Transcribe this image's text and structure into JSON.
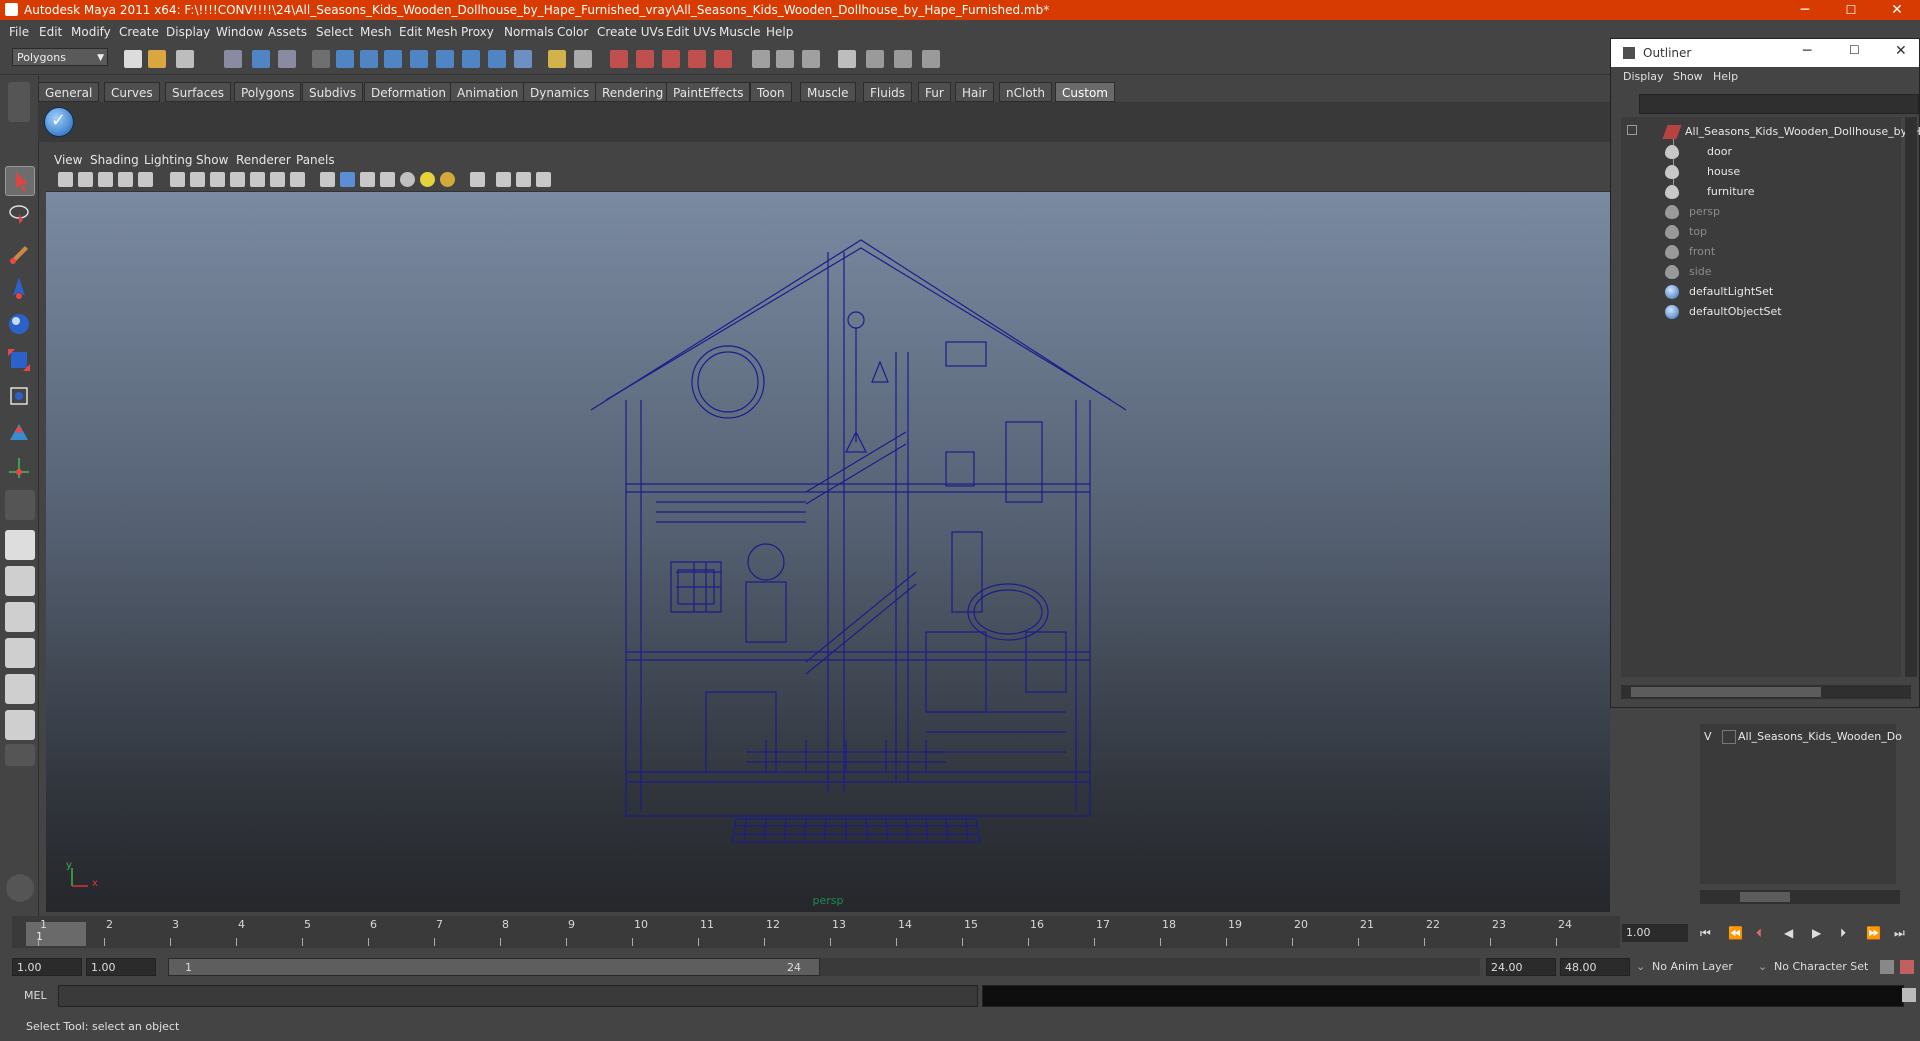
{
  "window": {
    "title": "Autodesk Maya 2011 x64: F:\\!!!!CONV!!!!\\24\\All_Seasons_Kids_Wooden_Dollhouse_by_Hape_Furnished_vray\\All_Seasons_Kids_Wooden_Dollhouse_by_Hape_Furnished.mb*",
    "accent": "#d83b01",
    "controls": {
      "minimize": "─",
      "maximize": "☐",
      "close": "✕"
    }
  },
  "menubar": [
    "File",
    "Edit",
    "Modify",
    "Create",
    "Display",
    "Window",
    "Assets",
    "Select",
    "Mesh",
    "Edit Mesh",
    "Proxy",
    "Normals",
    "Color",
    "Create UVs",
    "Edit UVs",
    "Muscle",
    "Help"
  ],
  "status_line": {
    "mode": "Polygons"
  },
  "shelf": {
    "tabs": [
      "General",
      "Curves",
      "Surfaces",
      "Polygons",
      "Subdivs",
      "Deformation",
      "Animation",
      "Dynamics",
      "Rendering",
      "PaintEffects",
      "Toon",
      "Muscle",
      "Fluids",
      "Fur",
      "Hair",
      "nCloth",
      "Custom"
    ],
    "active_tab": "Custom",
    "items": [
      "checkmark-icon"
    ]
  },
  "panel": {
    "menus": [
      "View",
      "Shading",
      "Lighting",
      "Show",
      "Renderer",
      "Panels"
    ],
    "camera_label": "persp",
    "axis": {
      "y": "y",
      "x": "x"
    },
    "wireframe_color": "#1c1c8a"
  },
  "outliner": {
    "title": "Outliner",
    "controls": {
      "minimize": "─",
      "maximize": "☐",
      "close": "✕"
    },
    "menus": [
      "Display",
      "Show",
      "Help"
    ],
    "items": [
      {
        "label": "All_Seasons_Kids_Wooden_Dollhouse_by_Ha",
        "icon": "mesh-group-icon",
        "level": 0,
        "dim": false
      },
      {
        "label": "door",
        "icon": "visibility-eye-icon",
        "level": 1,
        "dim": false
      },
      {
        "label": "house",
        "icon": "visibility-eye-icon",
        "level": 1,
        "dim": false
      },
      {
        "label": "furniture",
        "icon": "visibility-eye-icon",
        "level": 1,
        "dim": false
      },
      {
        "label": "persp",
        "icon": "camera-icon",
        "level": 0,
        "dim": true
      },
      {
        "label": "top",
        "icon": "camera-icon",
        "level": 0,
        "dim": true
      },
      {
        "label": "front",
        "icon": "camera-icon",
        "level": 0,
        "dim": true
      },
      {
        "label": "side",
        "icon": "camera-icon",
        "level": 0,
        "dim": true
      },
      {
        "label": "defaultLightSet",
        "icon": "set-icon",
        "level": 0,
        "dim": false
      },
      {
        "label": "defaultObjectSet",
        "icon": "set-icon",
        "level": 0,
        "dim": false
      }
    ]
  },
  "layer_editor": {
    "layer_visible": "V",
    "layer_name": "All_Seasons_Kids_Wooden_Do"
  },
  "timeline": {
    "ticks": [
      "1",
      "2",
      "3",
      "4",
      "5",
      "6",
      "7",
      "8",
      "9",
      "10",
      "11",
      "12",
      "13",
      "14",
      "15",
      "16",
      "17",
      "18",
      "19",
      "20",
      "21",
      "22",
      "23",
      "24"
    ],
    "current_frame": "1",
    "current_time_field": "1.00"
  },
  "range": {
    "start": "1.00",
    "playback_start": "1.00",
    "slider_start": "1",
    "slider_end": "24",
    "playback_end": "24.00",
    "end": "48.00",
    "anim_layer": "No Anim Layer",
    "character_set": "No Character Set"
  },
  "command_line": {
    "label": "MEL"
  },
  "help_line": {
    "text": "Select Tool: select an object"
  }
}
